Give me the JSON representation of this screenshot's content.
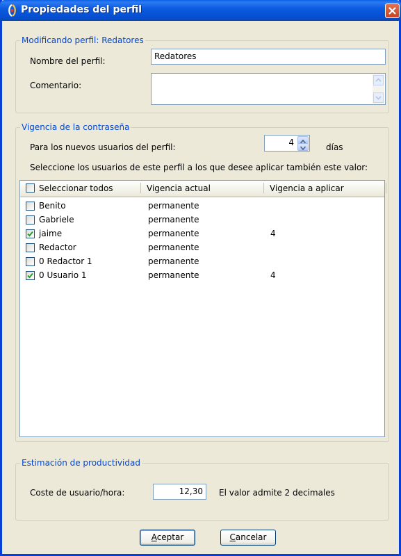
{
  "window": {
    "title": "Propiedades del perfil"
  },
  "profile_group": {
    "legend": "Modificando perfil: Redatores",
    "name_label": "Nombre del perfil:",
    "name_value": "Redatores",
    "comment_label": "Comentario:",
    "comment_value": ""
  },
  "password_group": {
    "legend": "Vigencia de la contraseña",
    "new_users_label": "Para los nuevos usuarios del perfil:",
    "days_value": "4",
    "days_unit": "días",
    "instruction": "Seleccione los usuarios de este perfil a los que desee aplicar también este valor:",
    "columns": [
      "Seleccionar todos",
      "Vigencia actual",
      "Vigencia a aplicar"
    ],
    "select_all_checked": false,
    "users": [
      {
        "name": "Benito",
        "current": "permanente",
        "apply": "",
        "checked": false
      },
      {
        "name": "Gabriele",
        "current": "permanente",
        "apply": "",
        "checked": false
      },
      {
        "name": "jaime",
        "current": "permanente",
        "apply": "4",
        "checked": true
      },
      {
        "name": "Redactor",
        "current": "permanente",
        "apply": "",
        "checked": false
      },
      {
        "name": "0 Redactor 1",
        "current": "permanente",
        "apply": "",
        "checked": false
      },
      {
        "name": "0 Usuario 1",
        "current": "permanente",
        "apply": "4",
        "checked": true
      }
    ]
  },
  "productivity_group": {
    "legend": "Estimación de productividad",
    "cost_label": "Coste de usuario/hora:",
    "cost_value": "12,30",
    "cost_hint": "El valor admite 2 decimales"
  },
  "buttons": {
    "accept_first": "A",
    "accept_rest": "ceptar",
    "cancel_first": "C",
    "cancel_rest": "ancelar"
  },
  "colors": {
    "titlebar": "#0A5FE8",
    "legend_text": "#0046D5",
    "dialog_bg": "#ECE9D8",
    "close_button": "#D8562F"
  }
}
